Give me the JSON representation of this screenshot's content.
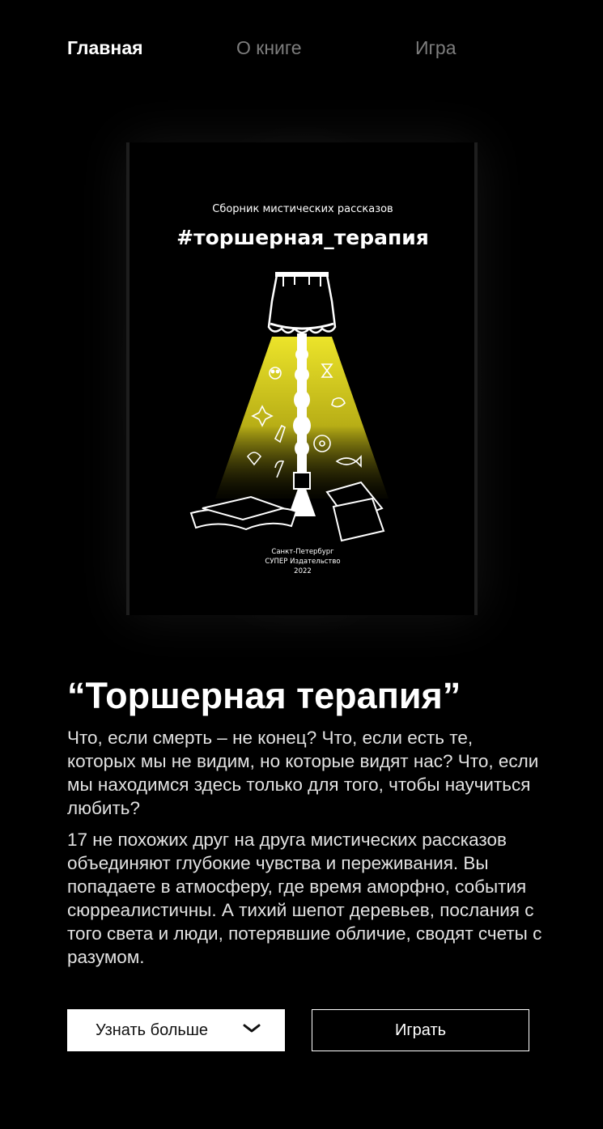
{
  "nav": {
    "items": [
      {
        "label": "Главная",
        "active": true
      },
      {
        "label": "О книге",
        "active": false
      },
      {
        "label": "Игра",
        "active": false
      }
    ]
  },
  "cover": {
    "subtitle": "Сборник мистических рассказов",
    "hashtag": "#торшерная_терапия",
    "city": "Санкт-Петербург",
    "publisher": "СУПЕР Издательство",
    "year": "2022",
    "light_color": "#e6dc22"
  },
  "book": {
    "title": "“Торшерная терапия”",
    "paragraph1": "Что, если смерть – не конец? Что, если есть те, которых мы не видим, но которые видят нас? Что, если мы находимся здесь только для того, чтобы научиться любить?",
    "paragraph2": "17 не похожих друг на друга мистических рассказов объединяют глубокие чувства и переживания. Вы попадаете в атмосферу, где время аморфно, события сюрреалистичны. А тихий шепот деревьев, послания с того света и люди, потерявшие обличие, сводят счеты с разумом."
  },
  "buttons": {
    "more_label": "Узнать больше",
    "more_icon": "chevron-down-icon",
    "play_label": "Играть"
  }
}
